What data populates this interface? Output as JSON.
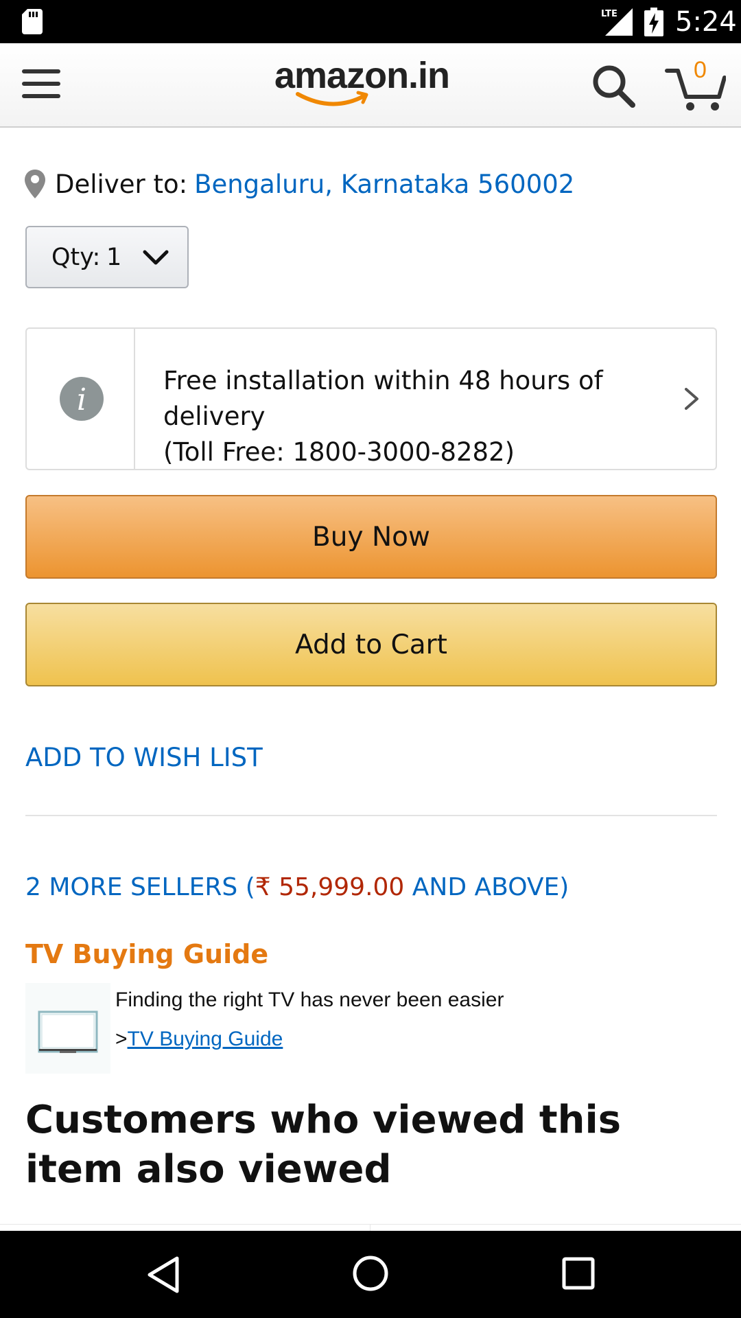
{
  "status_bar": {
    "time": "5:24",
    "network": "LTE"
  },
  "header": {
    "logo_text": "amazon.in",
    "cart_count": "0"
  },
  "deliver": {
    "label": "Deliver to:",
    "location": "Bengaluru, Karnataka 560002"
  },
  "quantity": {
    "label": "Qty:",
    "value": "1"
  },
  "installation": {
    "line1": "Free installation within 48 hours of delivery",
    "line2": "(Toll Free: 1800-3000-8282)"
  },
  "buttons": {
    "buy_now": "Buy Now",
    "add_to_cart": "Add to Cart"
  },
  "wishlist": {
    "label": "ADD TO WISH LIST"
  },
  "sellers": {
    "prefix": "2 MORE SELLERS (",
    "price": "₹ 55,999.00",
    "suffix": " AND ABOVE)"
  },
  "tv_guide": {
    "title": "TV Buying Guide",
    "description": "Finding the right TV has never been easier",
    "link_prefix": ">",
    "link_text": "TV Buying Guide"
  },
  "also_viewed": {
    "heading": "Customers who viewed this item also viewed"
  },
  "colors": {
    "link_blue": "#0066c0",
    "price_red": "#b12704",
    "orange_accent": "#e47911",
    "buy_now_orange": "#ec9430",
    "add_to_cart_yellow": "#efc24e"
  },
  "icons": [
    "sd-card-icon",
    "lte-signal-icon",
    "battery-charging-icon",
    "menu-icon",
    "search-icon",
    "cart-icon",
    "location-pin-icon",
    "chevron-down-icon",
    "info-icon",
    "chevron-right-icon",
    "tv-icon",
    "back-icon",
    "home-icon",
    "recents-icon"
  ]
}
